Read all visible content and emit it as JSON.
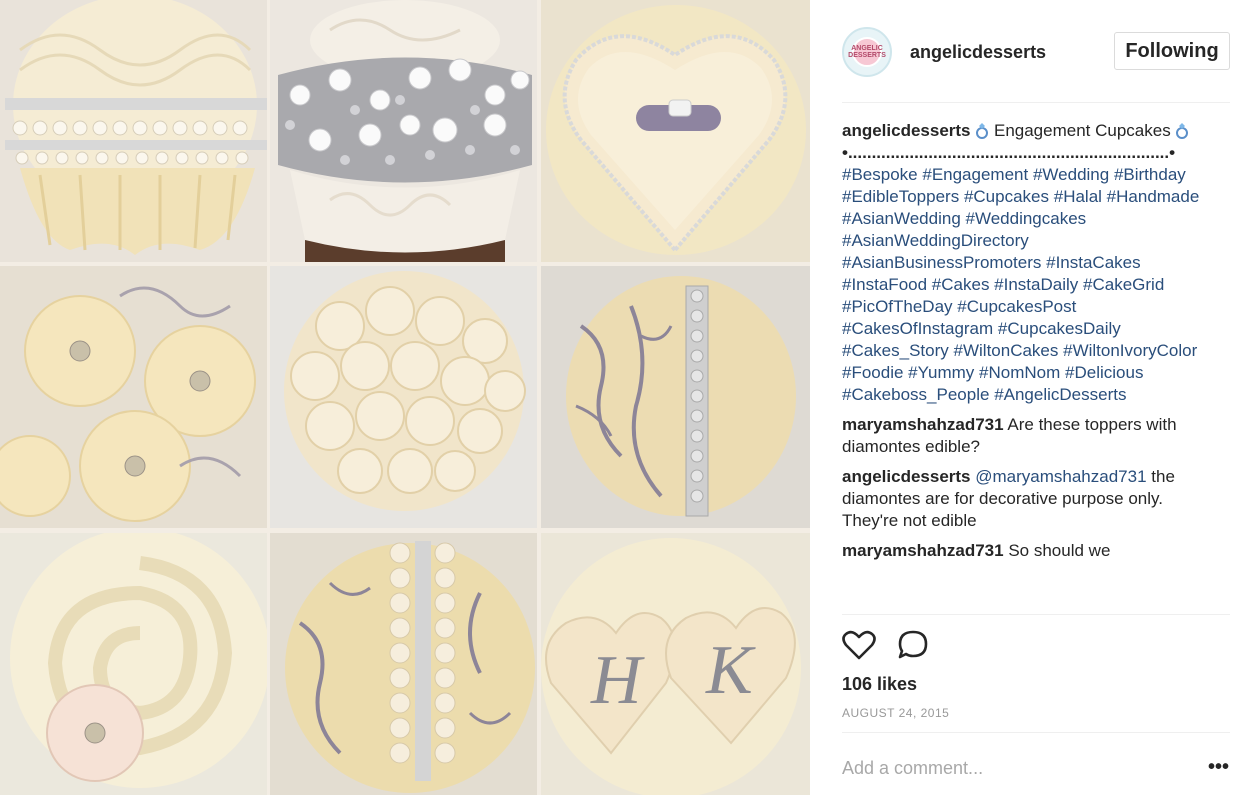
{
  "post": {
    "username": "angelicdesserts",
    "avatar_text": "ANGELIC DESSERTS",
    "follow_label": "Following",
    "caption": {
      "user": "angelicdesserts",
      "text_a": "Engagement",
      "text_b": "Cupcakes",
      "dotline": "•....................................................................•",
      "hashtags": [
        "#Bespoke",
        "#Engagement",
        "#Wedding",
        "#Birthday",
        "#EdibleToppers",
        "#Cupcakes",
        "#Halal",
        "#Handmade",
        "#AsianWedding",
        "#Weddingcakes",
        "#AsianWeddingDirectory",
        "#AsianBusinessPromoters",
        "#InstaCakes",
        "#InstaFood",
        "#Cakes",
        "#InstaDaily",
        "#CakeGrid",
        "#PicOfTheDay",
        "#CupcakesPost",
        "#CakesOfInstagram",
        "#CupcakesDaily",
        "#Cakes_Story",
        "#WiltonCakes",
        "#WiltonIvoryColor",
        "#Foodie",
        "#Yummy",
        "#NomNom",
        "#Delicious",
        "#Cakeboss_People",
        "#AngelicDesserts"
      ]
    },
    "comments": [
      {
        "user": "maryamshahzad731",
        "mention": "",
        "text": "Are these toppers with diamontes edible?"
      },
      {
        "user": "angelicdesserts",
        "mention": "@maryamshahzad731",
        "text": "the diamontes are for decorative purpose only. They're not edible"
      },
      {
        "user": "maryamshahzad731",
        "mention": "",
        "text": "So should we"
      }
    ],
    "likes": "106 likes",
    "date": "AUGUST 24, 2015",
    "add_comment_placeholder": "Add a comment...",
    "more_label": "•••",
    "icons": {
      "like": "heart-icon",
      "comment": "comment-bubble-icon",
      "emoji": "ring-emoji-icon",
      "more": "more-options-icon"
    },
    "colors": {
      "hashtag": "#2a4e7b",
      "text": "#262626",
      "muted": "#999999",
      "cream": "#f4e8c8"
    }
  }
}
